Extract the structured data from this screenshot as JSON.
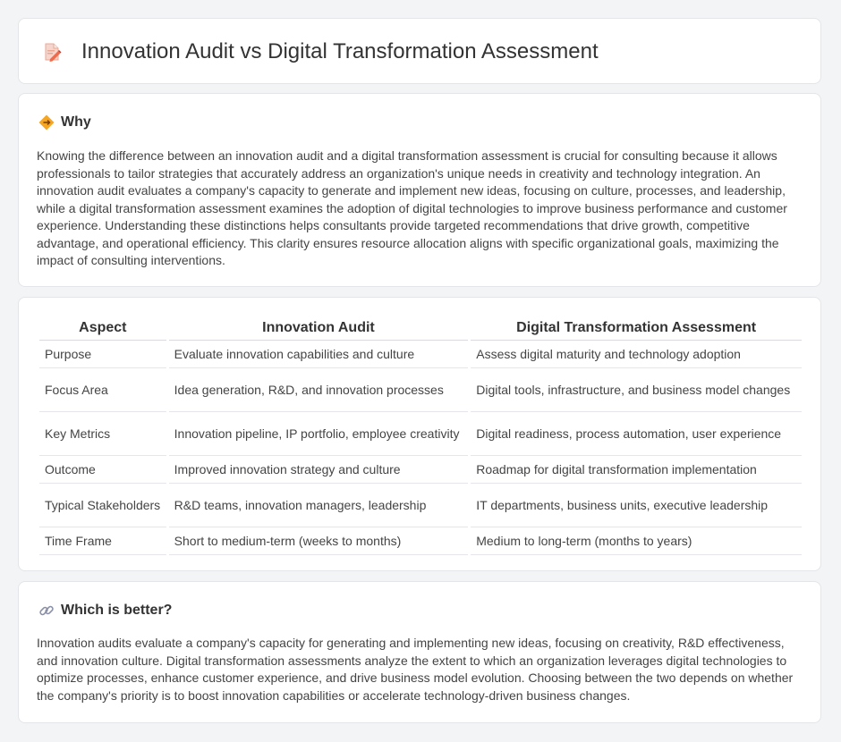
{
  "header": {
    "title": "Innovation Audit vs Digital Transformation Assessment",
    "icon": "document-pencil-icon"
  },
  "why": {
    "title": "Why",
    "icon": "diamond-arrows-icon",
    "text": "Knowing the difference between an innovation audit and a digital transformation assessment is crucial for consulting because it allows professionals to tailor strategies that accurately address an organization's unique needs in creativity and technology integration. An innovation audit evaluates a company's capacity to generate and implement new ideas, focusing on culture, processes, and leadership, while a digital transformation assessment examines the adoption of digital technologies to improve business performance and customer experience. Understanding these distinctions helps consultants provide targeted recommendations that drive growth, competitive advantage, and operational efficiency. This clarity ensures resource allocation aligns with specific organizational goals, maximizing the impact of consulting interventions."
  },
  "table": {
    "headers": [
      "Aspect",
      "Innovation Audit",
      "Digital Transformation Assessment"
    ],
    "rows": [
      [
        "Purpose",
        "Evaluate innovation capabilities and culture",
        "Assess digital maturity and technology adoption"
      ],
      [
        "Focus Area",
        "Idea generation, R&D, and innovation processes",
        "Digital tools, infrastructure, and business model changes"
      ],
      [
        "Key Metrics",
        "Innovation pipeline, IP portfolio, employee creativity",
        "Digital readiness, process automation, user experience"
      ],
      [
        "Outcome",
        "Improved innovation strategy and culture",
        "Roadmap for digital transformation implementation"
      ],
      [
        "Typical Stakeholders",
        "R&D teams, innovation managers, leadership",
        "IT departments, business units, executive leadership"
      ],
      [
        "Time Frame",
        "Short to medium-term (weeks to months)",
        "Medium to long-term (months to years)"
      ]
    ]
  },
  "better": {
    "title": "Which is better?",
    "icon": "link-icon",
    "text": "Innovation audits evaluate a company's capacity for generating and implementing new ideas, focusing on creativity, R&D effectiveness, and innovation culture. Digital transformation assessments analyze the extent to which an organization leverages digital technologies to optimize processes, enhance customer experience, and drive business model evolution. Choosing between the two depends on whether the company's priority is to boost innovation capabilities or accelerate technology-driven business changes."
  },
  "colors": {
    "background": "#f3f4f6",
    "card": "#ffffff",
    "icon_accent": "#f08a5d",
    "diamond_accent": "#f5a623"
  }
}
